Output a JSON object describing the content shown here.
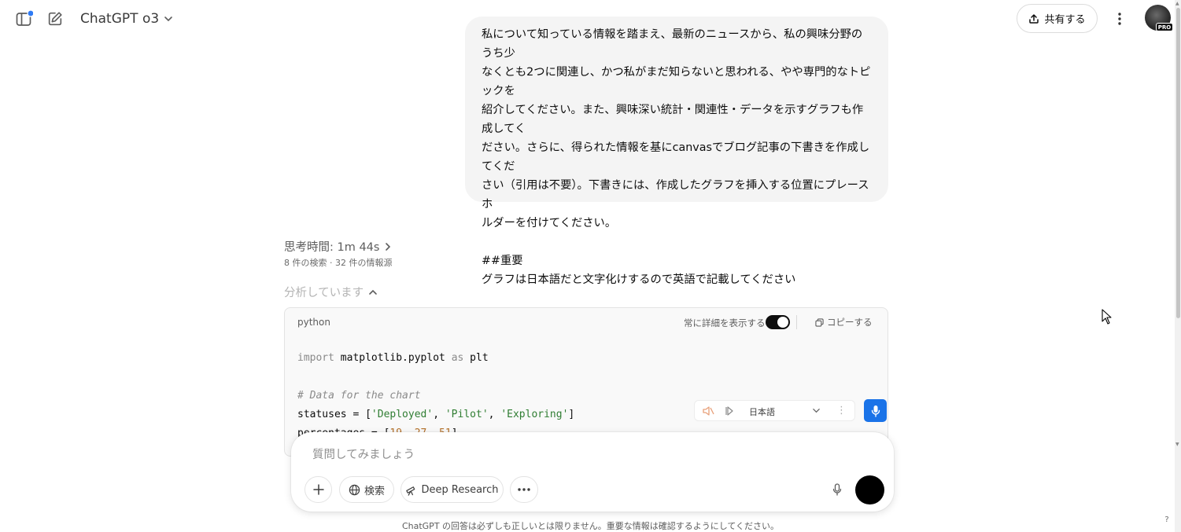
{
  "header": {
    "model_name": "ChatGPT o3",
    "share_label": "共有する",
    "avatar_badge": "PRO"
  },
  "user_message": {
    "lines": [
      "私について知っている情報を踏まえ、最新のニュースから、私の興味分野のうち少",
      "なくとも2つに関連し、かつ私がまだ知らないと思われる、やや専門的なトピックを",
      "紹介してください。また、興味深い統計・関連性・データを示すグラフも作成してく",
      "ださい。さらに、得られた情報を基にcanvasでブログ記事の下書きを作成してくだ",
      "さい（引用は不要）。下書きには、作成したグラフを挿入する位置にプレースホ",
      "ルダーを付けてください。"
    ],
    "heading": "##重要",
    "note": "グラフは日本語だと文字化けするので英語で記載してください"
  },
  "thinking": {
    "label": "思考時間: 1m 44s",
    "sources": "8 件の検索 · 32 件の情報源",
    "analyzing_label": "分析しています"
  },
  "code_block": {
    "language": "python",
    "always_show_details_label": "常に詳細を表示する",
    "copy_label": "コピーする",
    "line1_kw1": "import",
    "line1_mod": " matplotlib.pyplot ",
    "line1_kw2": "as",
    "line1_alias": " plt",
    "comment": "# Data for the chart",
    "line4_var": "statuses = [",
    "status_1": "'Deployed'",
    "status_2": "'Pilot'",
    "status_3": "'Exploring'",
    "sep": ", ",
    "line4_end": "]",
    "line5_var": "percentages = [",
    "pct_1": "19",
    "pct_2": "27",
    "pct_3": "51",
    "line5_end": "]"
  },
  "voice_bar": {
    "language": "日本語"
  },
  "composer": {
    "placeholder": "質問してみましょう",
    "search_label": "検索",
    "deep_research_label": "Deep Research"
  },
  "footer": {
    "disclaimer": "ChatGPT の回答は必ずしも正しいとは限りません。重要な情報は確認するようにしてください。",
    "help": "?"
  },
  "colors": {
    "accent_blue": "#1a73e8",
    "notification_dot": "#2f7bf5",
    "bubble_bg": "#f4f4f4",
    "code_string": "#2f7d32",
    "code_number": "#b5722b"
  },
  "icons": [
    "sidebar-icon",
    "notification-dot",
    "new-chat-icon",
    "chevron-down-icon",
    "share-icon",
    "more-vertical-icon",
    "chevron-right-icon",
    "chevron-up-icon",
    "copy-icon",
    "mute-icon",
    "skip-icon",
    "ellipsis-vertical-icon",
    "microphone-icon",
    "plus-icon",
    "globe-icon",
    "telescope-icon",
    "ellipsis-icon",
    "cursor-icon"
  ]
}
